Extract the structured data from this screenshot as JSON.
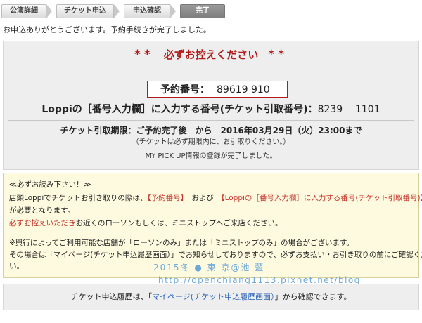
{
  "steps": [
    "公演詳細",
    "チケット申込",
    "申込確認",
    "完了"
  ],
  "thanks": "お申込ありがとうございます。予約手続きが完了しました。",
  "notice": {
    "stars": "**",
    "text": "必ずお控えください"
  },
  "reservation": {
    "label": "予約番号：",
    "value": "89619 910"
  },
  "loppi": {
    "label": "Loppiの［番号入力欄］に入力する番号(チケット引取番号)：",
    "value": "8239    1101"
  },
  "deadline": {
    "text": "チケット引取期限：ご予約完了後　から　2016年03月29日（火）23:00まで",
    "note": "（チケットは必ず期限内に、お引取りください。）"
  },
  "mypick": "MY PICK UP情報の登録が完了しました。",
  "must_read": {
    "title": "≪必ずお読み下さい！≫",
    "line1_a": "店頭Loppiでチケットお引き取りの際は、",
    "line1_b": "【予約番号】",
    "line1_c": "　および　",
    "line1_d": "【Loppiの［番号入力欄］に入力する番号(チケット引取番号)】",
    "line2": "が必要となります。",
    "line3_a": "必ずお控えいただき",
    "line3_b": "お近くのローソンもしくは、ミニストップへご来店ください。",
    "line4": "※興行によってご利用可能な店舗が「ローソンのみ」または「ミニストップのみ」の場合がございます。",
    "line5": "その場合は「マイページ(チケット申込履歴画面）」でお知らせしておりますので、必ずお支払い・お引き取りの前にご確認くださ",
    "line6": "い。"
  },
  "watermark": {
    "text": "2015冬 ● 東 京@池 藍",
    "url": "http://openchiang1113.pixnet.net/blog"
  },
  "history": {
    "prefix": "チケット申込履歴は、「",
    "link": "マイページ(チケット申込履歴画面）",
    "suffix": "」から確認できます。"
  },
  "colors": {
    "accent_red": "#b01a1a",
    "link_blue": "#2a63b5",
    "notice_bg": "#fdfae0"
  }
}
